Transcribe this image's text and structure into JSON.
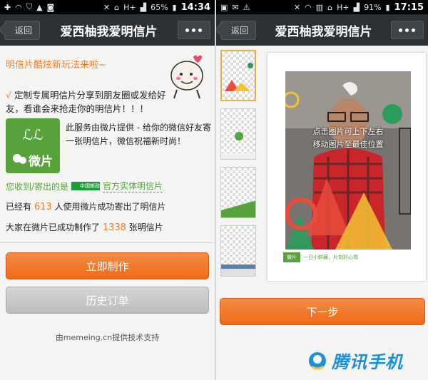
{
  "left": {
    "status": {
      "battery": "65%",
      "time": "14:34",
      "network": "H+"
    },
    "nav": {
      "back": "返回",
      "title": "爱西柚我爱明信片"
    },
    "promo_title": "明信片酷炫新玩法来啦~",
    "desc": "定制专属明信片分享到朋友圈或发给好友，看谁会来抢走你的明信片！！！",
    "desc_tick": "√",
    "logo_text": "微片",
    "service_text": "此服务由微片提供 - 给你的微信好友寄一张明信片，微信祝福新时尚！",
    "receive": {
      "prefix": "您收到/寄出的是",
      "badge": "中国邮政",
      "link": "官方实体明信片"
    },
    "stats": {
      "sent_prefix": "已经有",
      "sent_count": "613",
      "sent_suffix": "人使用微片成功寄出了明信片",
      "made_prefix": "大家在微片已成功制作了",
      "made_count": "1338",
      "made_suffix": "张明信片"
    },
    "primary_button": "立即制作",
    "secondary_button": "历史订单",
    "tech_support": "由memeing.cn提供技术支持"
  },
  "right": {
    "status": {
      "battery": "91%",
      "time": "17:15",
      "network": "H+"
    },
    "nav": {
      "back": "返回",
      "title": "爱西柚我爱明信片"
    },
    "hint_line1": "点击图片可上下左右",
    "hint_line2": "移动图片至最佳位置",
    "card_logo": "微片",
    "card_footer": "一日小鲜藏，片刻好心情",
    "next_button": "下一步",
    "watermark": "腾讯手机"
  },
  "colors": {
    "accent": "#f27f2c",
    "green": "#58a23b",
    "navbar": "#2e3134",
    "watermark_blue": "#1d8fd8"
  }
}
